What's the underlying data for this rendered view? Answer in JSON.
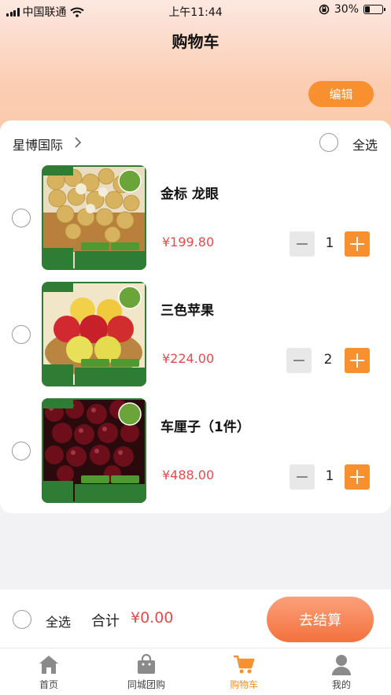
{
  "status_bar": {
    "carrier": "中国联通",
    "time": "上午11:44",
    "battery_percent_text": "30%",
    "battery_level": 0.3
  },
  "header": {
    "title": "购物车",
    "edit_label": "编辑"
  },
  "shop": {
    "name": "星博国际",
    "select_all_label": "全选"
  },
  "items": [
    {
      "name": "金标 龙眼",
      "price": "¥199.80",
      "quantity": "1",
      "thumb": {
        "brand": "星博严选",
        "badge": "清甜多汁",
        "tag1": "整件装",
        "tag2": "鲜美多汁",
        "weight_caption": "整件约计",
        "weight": "23",
        "unit": "斤",
        "slogan": "产地直发严选品质"
      }
    },
    {
      "name": "三色苹果",
      "price": "¥224.00",
      "quantity": "2",
      "thumb": {
        "brand": "星博严选",
        "badge": "甘甜可口",
        "tag1": "整件盒装",
        "tag2": "鲜美多汁",
        "weight_caption": "整件约计",
        "weight": "12",
        "unit": "斤",
        "slogan": "产地直发严选品质"
      }
    },
    {
      "name": "车厘子（1件）",
      "price": "¥488.00",
      "quantity": "1",
      "thumb": {
        "brand": "星博严选",
        "badge": "鲜嫩多汁",
        "tag1": "整件盒装",
        "tag2": "鲜美多汁",
        "weight_caption": "整件约计",
        "weight": "10",
        "unit": "斤",
        "slogan": "产地直发严选品质"
      }
    }
  ],
  "footer": {
    "select_all_label": "全选",
    "total_label": "合计",
    "total_value": "¥0.00",
    "checkout_label": "去结算"
  },
  "tabbar": [
    {
      "label": "首页",
      "icon": "home-icon"
    },
    {
      "label": "同城团购",
      "icon": "shopping-bag-icon"
    },
    {
      "label": "购物车",
      "icon": "cart-icon",
      "active": true
    },
    {
      "label": "我的",
      "icon": "user-icon"
    }
  ],
  "colors": {
    "accent": "#f8902f",
    "price": "#e54b4b",
    "checkout": "#f4713d"
  }
}
